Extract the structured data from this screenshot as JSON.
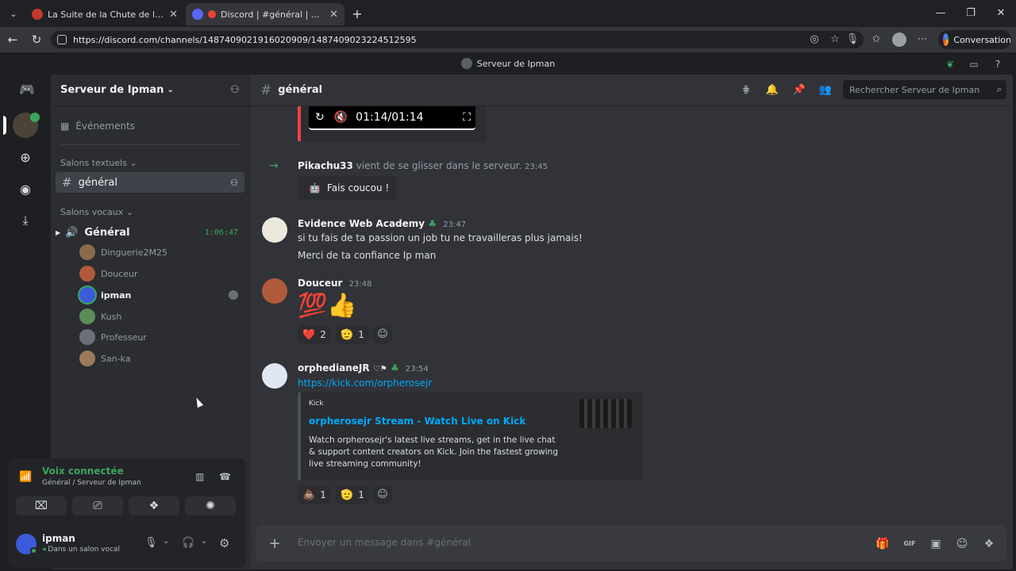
{
  "browser": {
    "tabs": [
      {
        "title": "La Suite de la Chute de la Cabale",
        "active": false
      },
      {
        "title": "Discord | #général | Serveur de Ipman",
        "active": true
      }
    ],
    "url": "https://discord.com/channels/1487409021916020909/1487409023224512595",
    "conversation_label": "Conversation"
  },
  "discord": {
    "window_title": "Serveur de Ipman",
    "server": {
      "name": "Serveur de Ipman"
    },
    "events_label": "Événements",
    "text_category": "Salons textuels",
    "text_channels": [
      {
        "name": "général",
        "selected": true
      }
    ],
    "voice_category": "Salons vocaux",
    "voice_channel": {
      "name": "Général",
      "timer": "1:06:47"
    },
    "voice_users": [
      {
        "name": "Dinguerie2M25",
        "color": "#8a6a4a"
      },
      {
        "name": "Douceur",
        "color": "#b05a3c"
      },
      {
        "name": "ipman",
        "color": "#3b5bdb",
        "active": true
      },
      {
        "name": "Kush",
        "color": "#5b8c5a"
      },
      {
        "name": "Professeur",
        "color": "#6c6f78"
      },
      {
        "name": "San-ka",
        "color": "#9a7b5a"
      }
    ],
    "voice_status": {
      "title": "Voix connectée",
      "subtitle": "Général / Serveur de Ipman"
    },
    "current_user": {
      "name": "ipman",
      "status": "Dans un salon vocal"
    },
    "channel_header": {
      "name": "général",
      "search_placeholder": "Rechercher Serveur de Ipman"
    },
    "video_time": "01:14/01:14",
    "messages": {
      "join": {
        "user": "Pikachu33",
        "text": "vient de se glisser dans le serveur.",
        "time": "23:45",
        "wave_button": "Fais coucou !"
      },
      "m1": {
        "user": "Evidence Web Academy",
        "time": "23:47",
        "line1": "si tu fais de ta passion un job tu ne travailleras plus jamais!",
        "line2": "Merci de ta confiance Ip man"
      },
      "m2": {
        "user": "Douceur",
        "time": "23:48",
        "emoji": "💯👍",
        "reactions": [
          {
            "emoji": "❤️",
            "count": "2"
          },
          {
            "emoji": "🫡",
            "count": "1"
          }
        ]
      },
      "m3": {
        "user": "orphedianeJR",
        "time": "23:54",
        "link": "https://kick.com/orpherosejr",
        "embed": {
          "provider": "Kick",
          "title": "orpherosejr Stream - Watch Live on Kick",
          "description": "Watch orpherosejr's latest live streams, get in the live chat & support content creators on Kick. Join the fastest growing live streaming community!"
        },
        "reactions": [
          {
            "emoji": "💩",
            "count": "1"
          },
          {
            "emoji": "🫡",
            "count": "1"
          }
        ]
      }
    },
    "composer_placeholder": "Envoyer un message dans #général"
  }
}
